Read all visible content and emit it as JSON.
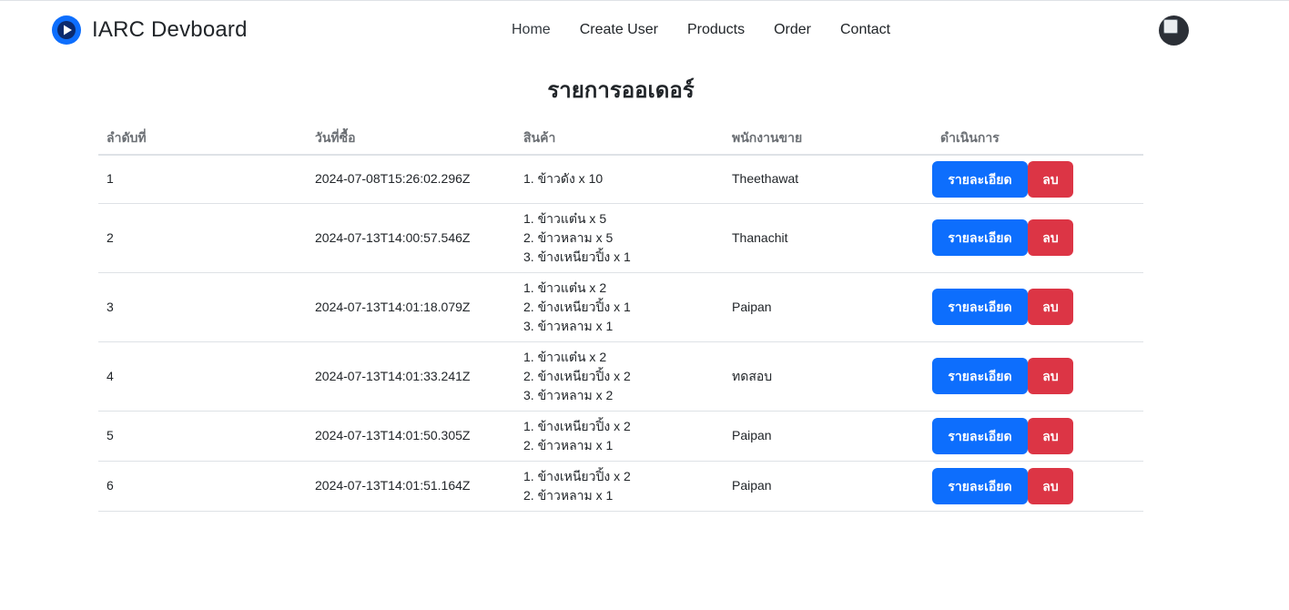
{
  "brand": {
    "name": "IARC Devboard",
    "logo_icon": "play-circle-icon",
    "logo_color": "#0d6efd"
  },
  "nav": {
    "items": [
      {
        "label": "Home"
      },
      {
        "label": "Create User"
      },
      {
        "label": "Products"
      },
      {
        "label": "Order"
      },
      {
        "label": "Contact"
      }
    ]
  },
  "user": {
    "avatar_icon": "user-avatar"
  },
  "page": {
    "title": "รายการออเดอร์"
  },
  "table": {
    "headers": {
      "no": "ลำดับที่",
      "date": "วันที่ซื้อ",
      "products": "สินค้า",
      "employee": "พนักงานขาย",
      "actions": "ดำเนินการ"
    },
    "rows": [
      {
        "no": "1",
        "date": "2024-07-08T15:26:02.296Z",
        "products": [
          "1. ข้าวดัง x 10"
        ],
        "employee": "Theethawat"
      },
      {
        "no": "2",
        "date": "2024-07-13T14:00:57.546Z",
        "products": [
          "1. ข้าวแต๋น x 5",
          "2. ข้าวหลาม x 5",
          "3. ข้างเหนียวปิ้ง x 1"
        ],
        "employee": "Thanachit"
      },
      {
        "no": "3",
        "date": "2024-07-13T14:01:18.079Z",
        "products": [
          "1. ข้าวแต๋น x 2",
          "2. ข้างเหนียวปิ้ง x 1",
          "3. ข้าวหลาม x 1"
        ],
        "employee": "Paipan"
      },
      {
        "no": "4",
        "date": "2024-07-13T14:01:33.241Z",
        "products": [
          "1. ข้าวแต๋น x 2",
          "2. ข้างเหนียวปิ้ง x 2",
          "3. ข้าวหลาม x 2"
        ],
        "employee": "ทดสอบ"
      },
      {
        "no": "5",
        "date": "2024-07-13T14:01:50.305Z",
        "products": [
          "1. ข้างเหนียวปิ้ง x 2",
          "2. ข้าวหลาม x 1"
        ],
        "employee": "Paipan"
      },
      {
        "no": "6",
        "date": "2024-07-13T14:01:51.164Z",
        "products": [
          "1. ข้างเหนียวปิ้ง x 2",
          "2. ข้าวหลาม x 1"
        ],
        "employee": "Paipan"
      }
    ],
    "detail_label": "รายละเอียด",
    "delete_label": "ลบ"
  },
  "colors": {
    "primary": "#0d6efd",
    "danger": "#dc3545",
    "border": "#dee2e6"
  }
}
